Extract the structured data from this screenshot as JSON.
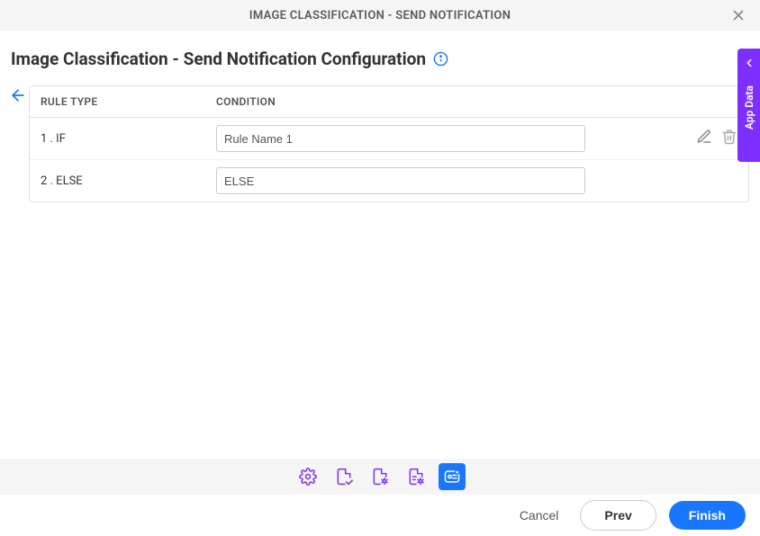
{
  "header": {
    "title": "IMAGE CLASSIFICATION - SEND NOTIFICATION"
  },
  "page": {
    "title": "Image Classification - Send Notification Configuration"
  },
  "table": {
    "col_type": "RULE TYPE",
    "col_cond": "CONDITION",
    "rows": [
      {
        "type": "1 . IF",
        "condition": "Rule Name 1",
        "editable": true
      },
      {
        "type": "2 . ELSE",
        "condition": "ELSE",
        "editable": false
      }
    ]
  },
  "sidebar": {
    "label": "App Data"
  },
  "footer": {
    "cancel": "Cancel",
    "prev": "Prev",
    "finish": "Finish"
  }
}
